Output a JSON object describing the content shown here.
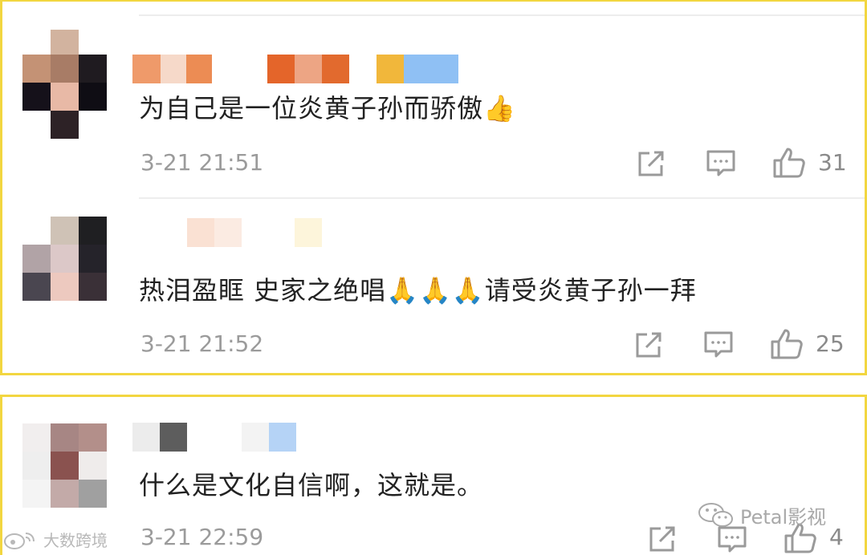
{
  "comments": [
    {
      "text": "为自己是一位炎黄子孙而骄傲👍",
      "time": "3-21 21:51",
      "likes": "31"
    },
    {
      "text": "热泪盈眶 史家之绝唱🙏🙏🙏请受炎黄子孙一拜",
      "time": "3-21 21:52",
      "likes": "25"
    },
    {
      "text": "什么是文化自信啊，这就是。",
      "time": "3-21 22:59",
      "likes": "4"
    }
  ],
  "icons": {
    "share": "share-icon",
    "reply": "comment-icon",
    "like": "thumbs-up-icon"
  },
  "watermarks": {
    "left": "大数跨境",
    "right": "Petal影视"
  },
  "colors": {
    "highlight_border": "#f2d640",
    "meta_text": "#9b9b9b",
    "body_text": "#222222"
  }
}
